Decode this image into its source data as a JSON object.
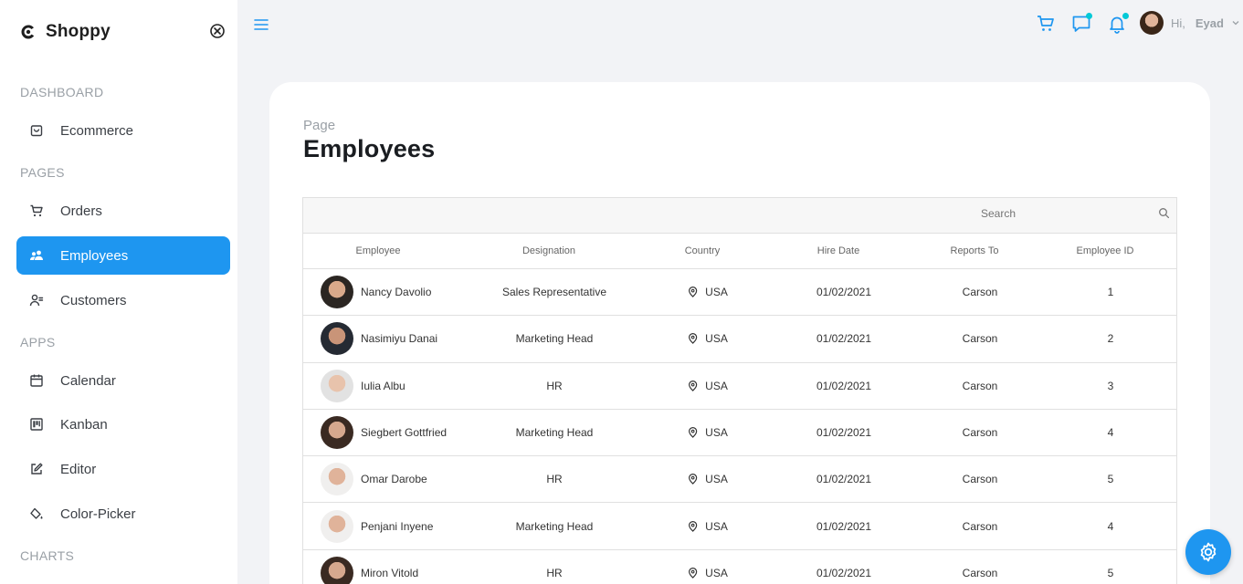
{
  "sidebar": {
    "brand": "Shoppy",
    "sections": [
      {
        "title": "DASHBOARD",
        "items": [
          {
            "label": "Ecommerce",
            "icon": "bag-icon"
          }
        ]
      },
      {
        "title": "PAGES",
        "items": [
          {
            "label": "Orders",
            "icon": "cart-icon"
          },
          {
            "label": "Employees",
            "icon": "people-icon"
          },
          {
            "label": "Customers",
            "icon": "customer-icon"
          }
        ]
      },
      {
        "title": "APPS",
        "items": [
          {
            "label": "Calendar",
            "icon": "calendar-icon"
          },
          {
            "label": "Kanban",
            "icon": "kanban-icon"
          },
          {
            "label": "Editor",
            "icon": "edit-icon"
          },
          {
            "label": "Color-Picker",
            "icon": "paint-bucket-icon"
          }
        ]
      },
      {
        "title": "CHARTS",
        "items": []
      }
    ],
    "active_item": "Employees"
  },
  "topbar": {
    "greeting": "Hi,",
    "username": "Eyad"
  },
  "page": {
    "breadcrumb": "Page",
    "title": "Employees"
  },
  "grid": {
    "search_placeholder": "Search",
    "columns": [
      "Employee",
      "Designation",
      "Country",
      "Hire Date",
      "Reports To",
      "Employee ID"
    ],
    "rows": [
      {
        "name": "Nancy Davolio",
        "designation": "Sales Representative",
        "country": "USA",
        "hire_date": "01/02/2021",
        "reports_to": "Carson",
        "id": "1"
      },
      {
        "name": "Nasimiyu Danai",
        "designation": "Marketing Head",
        "country": "USA",
        "hire_date": "01/02/2021",
        "reports_to": "Carson",
        "id": "2"
      },
      {
        "name": "Iulia Albu",
        "designation": "HR",
        "country": "USA",
        "hire_date": "01/02/2021",
        "reports_to": "Carson",
        "id": "3"
      },
      {
        "name": "Siegbert Gottfried",
        "designation": "Marketing Head",
        "country": "USA",
        "hire_date": "01/02/2021",
        "reports_to": "Carson",
        "id": "4"
      },
      {
        "name": "Omar Darobe",
        "designation": "HR",
        "country": "USA",
        "hire_date": "01/02/2021",
        "reports_to": "Carson",
        "id": "5"
      },
      {
        "name": "Penjani Inyene",
        "designation": "Marketing Head",
        "country": "USA",
        "hire_date": "01/02/2021",
        "reports_to": "Carson",
        "id": "4"
      },
      {
        "name": "Miron Vitold",
        "designation": "HR",
        "country": "USA",
        "hire_date": "01/02/2021",
        "reports_to": "Carson",
        "id": "5"
      }
    ]
  },
  "colors": {
    "accent": "#1e96f0",
    "notification_dot": "#03c9d7"
  }
}
